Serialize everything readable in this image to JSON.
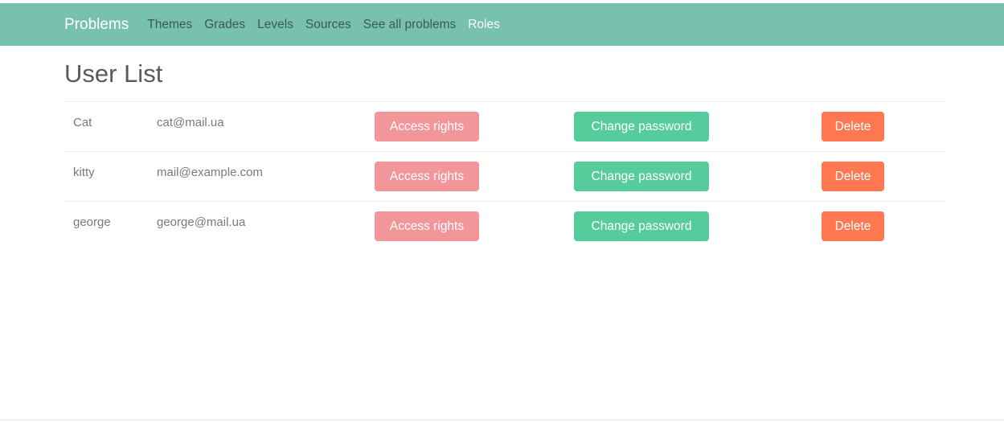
{
  "nav": {
    "brand": "Problems",
    "links": [
      {
        "label": "Themes"
      },
      {
        "label": "Grades"
      },
      {
        "label": "Levels"
      },
      {
        "label": "Sources"
      },
      {
        "label": "See all problems"
      },
      {
        "label": "Roles"
      }
    ]
  },
  "page": {
    "title": "User List"
  },
  "users": [
    {
      "name": "Cat",
      "email": "cat@mail.ua"
    },
    {
      "name": "kitty",
      "email": "mail@example.com"
    },
    {
      "name": "george",
      "email": "george@mail.ua"
    }
  ],
  "actions": {
    "access_label": "Access rights",
    "password_label": "Change password",
    "delete_label": "Delete"
  },
  "colors": {
    "navbar": "#78c2ad",
    "access": "#f3969a",
    "password": "#56cc9d",
    "delete": "#ff7851"
  }
}
